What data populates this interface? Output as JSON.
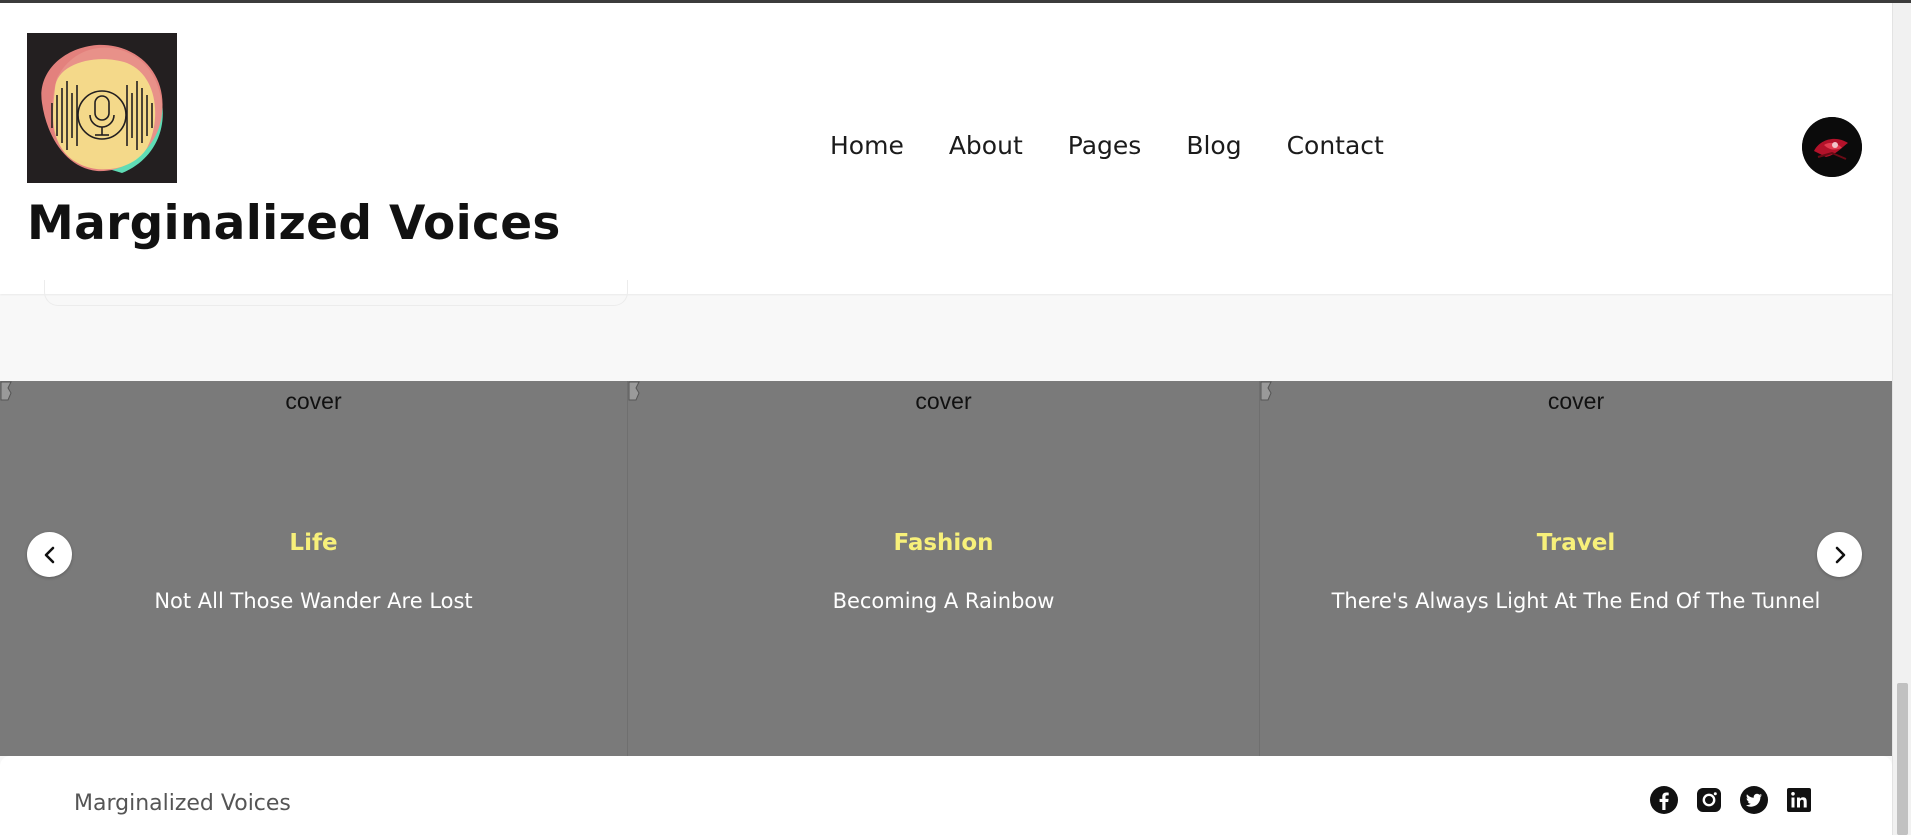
{
  "site": {
    "title": "Marginalized Voices"
  },
  "nav": {
    "items": [
      "Home",
      "About",
      "Pages",
      "Blog",
      "Contact"
    ]
  },
  "slider": {
    "slides": [
      {
        "image_alt": "cover",
        "category": "Life",
        "title": "Not All Those Wander Are Lost"
      },
      {
        "image_alt": "cover",
        "category": "Fashion",
        "title": "Becoming A Rainbow"
      },
      {
        "image_alt": "cover",
        "category": "Travel",
        "title": "There's Always Light At The End Of The Tunnel"
      }
    ],
    "prev_icon": "chevron-left-icon",
    "next_icon": "chevron-right-icon"
  },
  "footer": {
    "name": "Marginalized Voices",
    "socials": [
      "facebook-icon",
      "instagram-icon",
      "twitter-icon",
      "linkedin-icon"
    ]
  },
  "colors": {
    "category": "#f7f07a",
    "slider_bg": "#7a7a7a",
    "header_bg": "#ffffff",
    "page_bg": "#f8f8f8"
  }
}
